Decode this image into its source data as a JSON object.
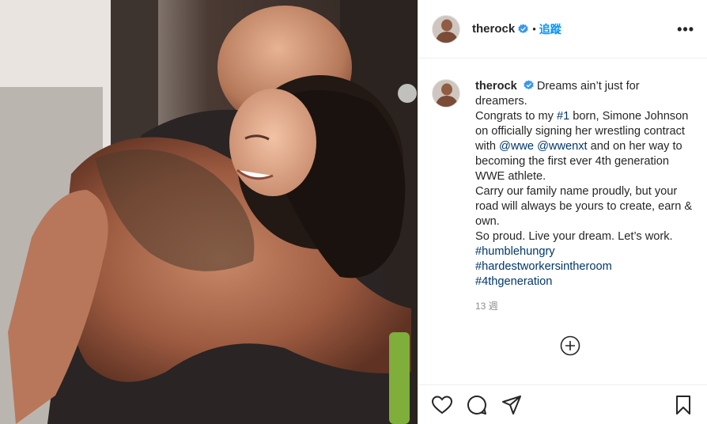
{
  "post": {
    "username": "therock",
    "follow_label": "追蹤",
    "separator": "•",
    "more_label": "•••",
    "caption": {
      "username": "therock",
      "line1": "Dreams ain’t just for dreamers.",
      "para2_a": "Congrats to my ",
      "para2_tag": "#1",
      "para2_b": " born, Simone Johnson on officially signing her wrestling contract with ",
      "mention1": "@wwe",
      "mention2": "@wwenxt",
      "para2_c": " and on her way to becoming the first ever 4th generation WWE athlete.",
      "para3": "Carry our family name proudly, but your road will always be yours to create, earn & own.",
      "para4": "So proud. Live your dream. Let’s work.",
      "hashtags": [
        "#humblehungry",
        "#hardestworkersintheroom",
        "#4thgeneration"
      ]
    },
    "time_ago": "13 週"
  },
  "icons": {
    "verified": "verified-badge-icon",
    "add_comment": "plus-circle-icon",
    "like": "heart-icon",
    "comment": "comment-icon",
    "share": "paper-plane-icon",
    "save": "bookmark-icon"
  },
  "colors": {
    "verified_blue": "#3897f0",
    "follow_blue": "#0095f6",
    "link_blue": "#00376b",
    "muted_gray": "#8e8e8e"
  }
}
